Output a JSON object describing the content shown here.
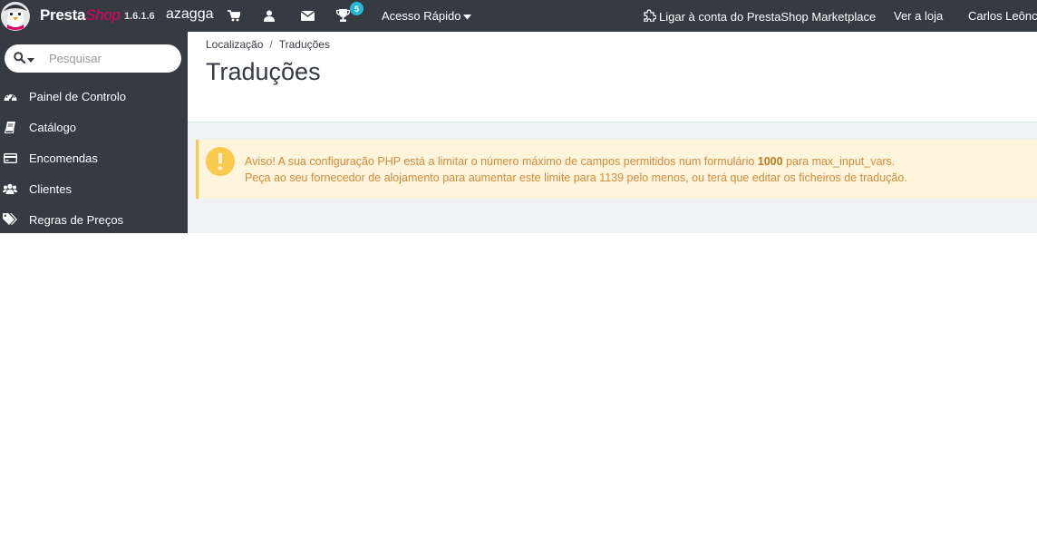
{
  "header": {
    "brand_presta": "Presta",
    "brand_shop": "Shop",
    "version": "1.6.1.6",
    "shop_name": "azagga",
    "notifications_count": "5",
    "quick_access": "Acesso Rápido",
    "marketplace": "Ligar à conta do PrestaShop Marketplace",
    "view_shop": "Ver a loja",
    "employee": "Carlos Leônci"
  },
  "sidebar": {
    "search_placeholder": "Pesquisar",
    "items": [
      {
        "label": "Painel de Controlo",
        "icon": "dashboard-icon"
      },
      {
        "label": "Catálogo",
        "icon": "book-icon"
      },
      {
        "label": "Encomendas",
        "icon": "credit-card-icon"
      },
      {
        "label": "Clientes",
        "icon": "users-icon"
      },
      {
        "label": "Regras de Preços",
        "icon": "tags-icon"
      }
    ]
  },
  "breadcrumb": {
    "parent": "Localização",
    "current": "Traduções"
  },
  "page": {
    "title": "Traduções"
  },
  "alert": {
    "line1_before": "Aviso! A sua configuração PHP está a limitar o número máximo de campos permitidos num formulário",
    "line1_bold": "1000",
    "line1_after": "para max_input_vars.",
    "line2": "Peça ao seu fornecedor de alojamento para aumentar este limite para 1139 pelo menos, ou terá que editar os ficheiros de tradução."
  },
  "colors": {
    "header_bg": "#363a41",
    "brand_pink": "#df0067",
    "badge": "#25b9d7",
    "alert_bg": "#fff4dc",
    "alert_border": "#fcc94f",
    "alert_text": "#d08c3c",
    "content_bg": "#eff1f2"
  }
}
